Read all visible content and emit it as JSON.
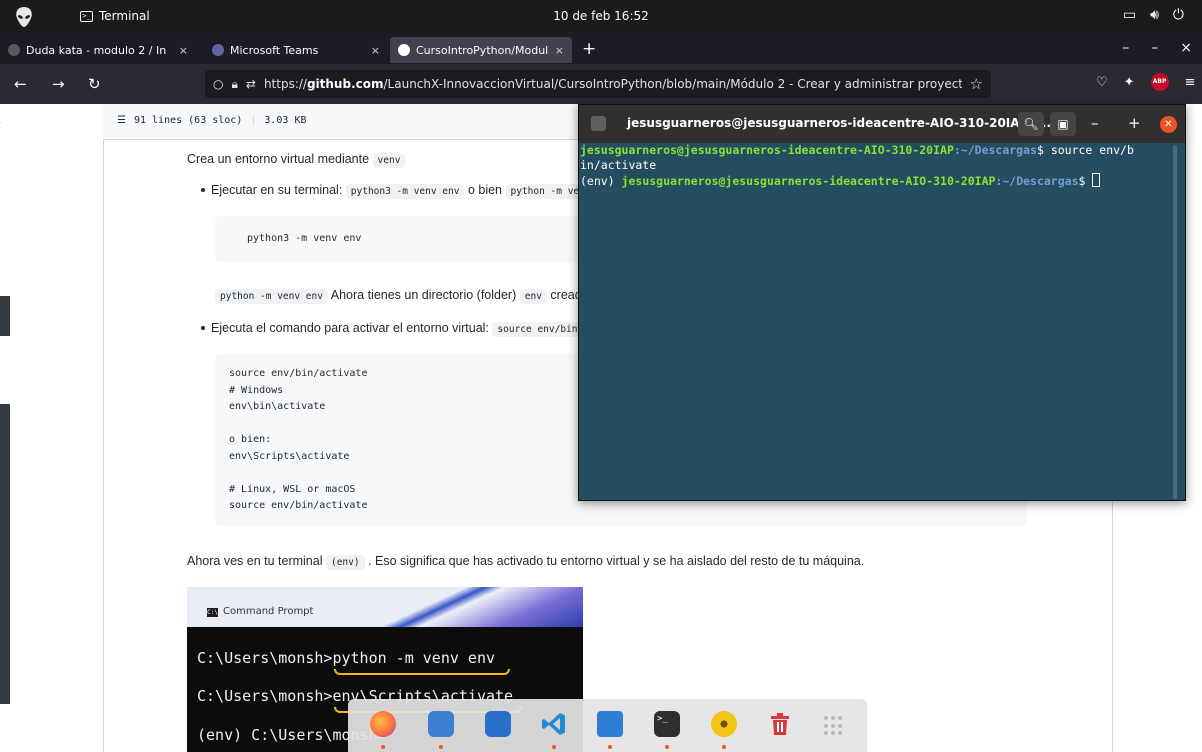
{
  "topbar": {
    "app_name": "Terminal",
    "clock": "10 de feb  16:52"
  },
  "browser": {
    "tabs": [
      {
        "label": "Duda kata - modulo 2 / In",
        "close": "×"
      },
      {
        "label": "Microsoft Teams",
        "close": "×"
      },
      {
        "label": "CursoIntroPython/Modul",
        "close": "×"
      }
    ],
    "new_tab": "+",
    "url_prefix": "https://",
    "url_host": "github.com",
    "url_path": "/LaunchX-InnovaccionVirtual/CursoIntroPython/blob/main/Módulo 2 - Crear y administrar proyecto"
  },
  "github": {
    "file_lines": "91 lines (63 sloc)",
    "file_size": "3.03 KB",
    "p_create": "Crea un entorno virtual mediante",
    "c_venv": "venv",
    "li_run": "Ejecutar en su terminal:",
    "c_cmd1": "python3 -m venv env",
    "o_bien": "o bien",
    "c_cmd2": "python -m venv env",
    "code1": "python3 -m venv env",
    "c_cmd3": "python -m venv env",
    "p_dir": "Ahora tienes un directorio (folder)",
    "c_env": "env",
    "p_dir_end": "creado en tu terminal.",
    "li_activate": "Ejecuta el comando para activar el entorno virtual:",
    "c_activate": "source env/bin/activate",
    "code2": "source env/bin/activate\n# Windows\nenv\\bin\\activate\n\no bien:\nenv\\Scripts\\activate\n\n# Linux, WSL or macOS\nsource env/bin/activate",
    "p_now": "Ahora ves en tu terminal",
    "c_env2": "(env)",
    "p_now_end": ". Eso significa que has activado tu entorno virtual y se ha aislado del resto de tu máquina."
  },
  "cmd_image": {
    "title": "Command Prompt",
    "line1": "C:\\Users\\monsh>python -m venv env",
    "line2": "C:\\Users\\monsh>env\\Scripts\\activate",
    "line3": "(env) C:\\Users\\monsh>"
  },
  "terminal": {
    "title": "jesusguarneros@jesusguarneros-ideacentre-AIO-310-20IAP: ...",
    "l1_prompt": "jesusguarneros@jesusguarneros-ideacentre-AIO-310-20IAP",
    "l1_path": ":~/Descargas",
    "l1_cmd": "$ source env/b",
    "l2": "in/activate",
    "l3_env": "(env) ",
    "l3_prompt": "jesusguarneros@jesusguarneros-ideacentre-AIO-310-20IAP",
    "l3_path": ":~/Descargas",
    "l3_end": "$ "
  },
  "colors": {
    "terminal_bg": "#244e5f",
    "prompt_green": "#8ae234",
    "prompt_blue": "#729fcf",
    "ubuntu_orange": "#e95420"
  },
  "dock_apps": [
    "firefox-icon",
    "files-icon",
    "software-icon",
    "vscode-icon",
    "document-icon",
    "terminal-icon",
    "disc-icon",
    "trash-icon",
    "app-grid-icon"
  ]
}
